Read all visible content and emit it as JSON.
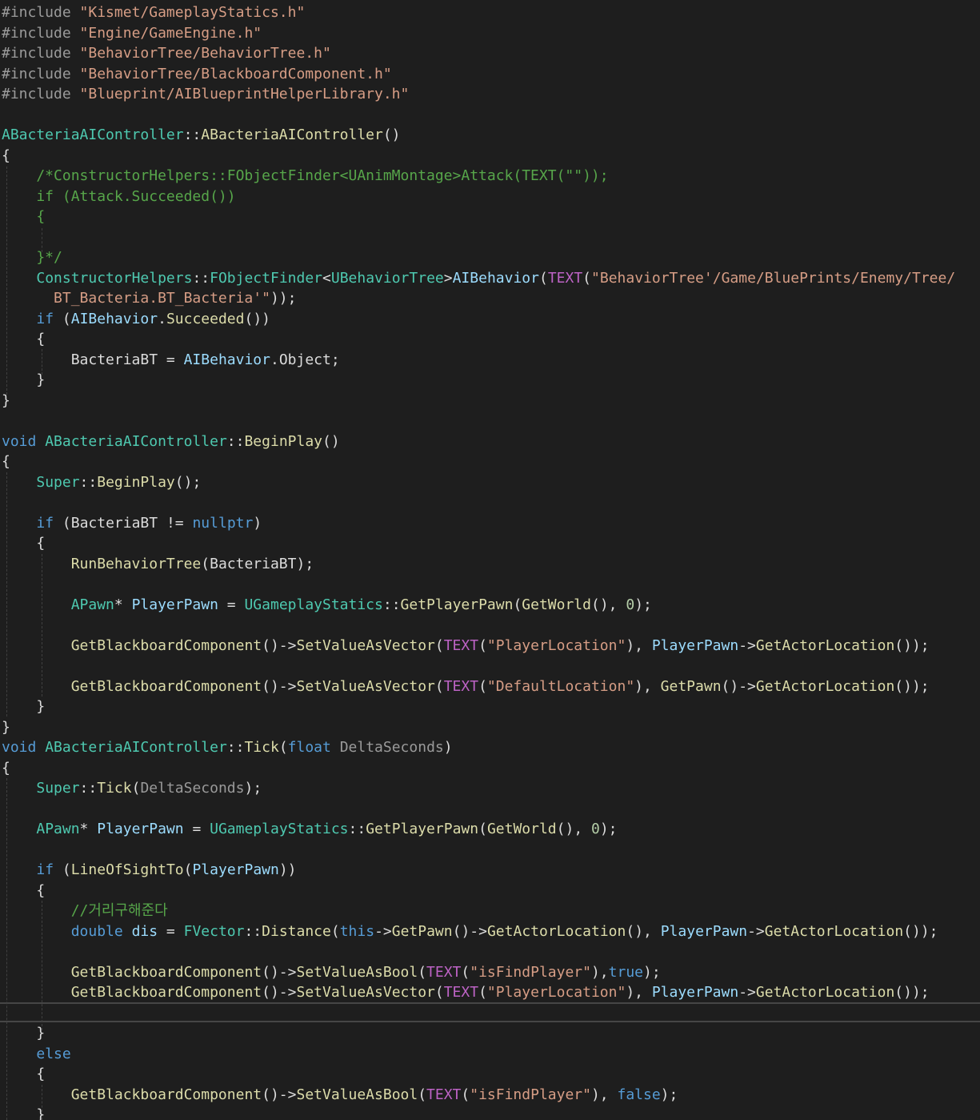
{
  "editor": {
    "colors": {
      "background": "#1e1e1e",
      "plain": "#dcdcdc",
      "keyword": "#569cd6",
      "type": "#4ec9b0",
      "function": "#dcdcaa",
      "string": "#d69d85",
      "comment": "#57a64a",
      "macro": "#bd63c5",
      "parameter": "#9a9a9a",
      "variable": "#9cdcfe",
      "number": "#b5cea8",
      "include": "#9b9b9b"
    },
    "lines": [
      [
        {
          "t": "#include ",
          "c": "include"
        },
        {
          "t": "\"Kismet/GameplayStatics.h\"",
          "c": "string"
        }
      ],
      [
        {
          "t": "#include ",
          "c": "include"
        },
        {
          "t": "\"Engine/GameEngine.h\"",
          "c": "string"
        }
      ],
      [
        {
          "t": "#include ",
          "c": "include"
        },
        {
          "t": "\"BehaviorTree/BehaviorTree.h\"",
          "c": "string"
        }
      ],
      [
        {
          "t": "#include ",
          "c": "include"
        },
        {
          "t": "\"BehaviorTree/BlackboardComponent.h\"",
          "c": "string"
        }
      ],
      [
        {
          "t": "#include ",
          "c": "include"
        },
        {
          "t": "\"Blueprint/AIBlueprintHelperLibrary.h\"",
          "c": "string"
        }
      ],
      [],
      [
        {
          "t": "ABacteriaAIController",
          "c": "type"
        },
        {
          "t": "::",
          "c": "plain"
        },
        {
          "t": "ABacteriaAIController",
          "c": "function"
        },
        {
          "t": "()",
          "c": "plain"
        }
      ],
      [
        {
          "t": "{",
          "c": "plain"
        }
      ],
      [
        {
          "t": "    /*ConstructorHelpers::FObjectFinder<UAnimMontage>Attack(TEXT(\"\"));",
          "c": "comment"
        }
      ],
      [
        {
          "t": "    if (Attack.Succeeded())",
          "c": "comment"
        }
      ],
      [
        {
          "t": "    {",
          "c": "comment"
        }
      ],
      [],
      [
        {
          "t": "    }*/",
          "c": "comment"
        }
      ],
      [
        {
          "t": "    ",
          "c": "plain"
        },
        {
          "t": "ConstructorHelpers",
          "c": "type"
        },
        {
          "t": "::",
          "c": "plain"
        },
        {
          "t": "FObjectFinder",
          "c": "type"
        },
        {
          "t": "<",
          "c": "plain"
        },
        {
          "t": "UBehaviorTree",
          "c": "type"
        },
        {
          "t": ">",
          "c": "plain"
        },
        {
          "t": "AIBehavior",
          "c": "variable"
        },
        {
          "t": "(",
          "c": "plain"
        },
        {
          "t": "TEXT",
          "c": "macro"
        },
        {
          "t": "(",
          "c": "plain"
        },
        {
          "t": "\"BehaviorTree'/Game/BluePrints/Enemy/Tree/",
          "c": "string"
        }
      ],
      [
        {
          "t": "      BT_Bacteria.BT_Bacteria'\"",
          "c": "string"
        },
        {
          "t": "));",
          "c": "plain"
        }
      ],
      [
        {
          "t": "    ",
          "c": "plain"
        },
        {
          "t": "if",
          "c": "keyword"
        },
        {
          "t": " (",
          "c": "plain"
        },
        {
          "t": "AIBehavior",
          "c": "variable"
        },
        {
          "t": ".",
          "c": "plain"
        },
        {
          "t": "Succeeded",
          "c": "function"
        },
        {
          "t": "())",
          "c": "plain"
        }
      ],
      [
        {
          "t": "    {",
          "c": "plain"
        }
      ],
      [
        {
          "t": "        ",
          "c": "plain"
        },
        {
          "t": "BacteriaBT",
          "c": "plain"
        },
        {
          "t": " = ",
          "c": "plain"
        },
        {
          "t": "AIBehavior",
          "c": "variable"
        },
        {
          "t": ".",
          "c": "plain"
        },
        {
          "t": "Object",
          "c": "plain"
        },
        {
          "t": ";",
          "c": "plain"
        }
      ],
      [
        {
          "t": "    }",
          "c": "plain"
        }
      ],
      [
        {
          "t": "}",
          "c": "plain"
        }
      ],
      [],
      [
        {
          "t": "void",
          "c": "keyword"
        },
        {
          "t": " ",
          "c": "plain"
        },
        {
          "t": "ABacteriaAIController",
          "c": "type"
        },
        {
          "t": "::",
          "c": "plain"
        },
        {
          "t": "BeginPlay",
          "c": "function"
        },
        {
          "t": "()",
          "c": "plain"
        }
      ],
      [
        {
          "t": "{",
          "c": "plain"
        }
      ],
      [
        {
          "t": "    ",
          "c": "plain"
        },
        {
          "t": "Super",
          "c": "type"
        },
        {
          "t": "::",
          "c": "plain"
        },
        {
          "t": "BeginPlay",
          "c": "function"
        },
        {
          "t": "();",
          "c": "plain"
        }
      ],
      [],
      [
        {
          "t": "    ",
          "c": "plain"
        },
        {
          "t": "if",
          "c": "keyword"
        },
        {
          "t": " (",
          "c": "plain"
        },
        {
          "t": "BacteriaBT",
          "c": "plain"
        },
        {
          "t": " != ",
          "c": "plain"
        },
        {
          "t": "nullptr",
          "c": "keyword"
        },
        {
          "t": ")",
          "c": "plain"
        }
      ],
      [
        {
          "t": "    {",
          "c": "plain"
        }
      ],
      [
        {
          "t": "        ",
          "c": "plain"
        },
        {
          "t": "RunBehaviorTree",
          "c": "function"
        },
        {
          "t": "(",
          "c": "plain"
        },
        {
          "t": "BacteriaBT",
          "c": "plain"
        },
        {
          "t": ");",
          "c": "plain"
        }
      ],
      [],
      [
        {
          "t": "        ",
          "c": "plain"
        },
        {
          "t": "APawn",
          "c": "type"
        },
        {
          "t": "* ",
          "c": "plain"
        },
        {
          "t": "PlayerPawn",
          "c": "variable"
        },
        {
          "t": " = ",
          "c": "plain"
        },
        {
          "t": "UGameplayStatics",
          "c": "type"
        },
        {
          "t": "::",
          "c": "plain"
        },
        {
          "t": "GetPlayerPawn",
          "c": "function"
        },
        {
          "t": "(",
          "c": "plain"
        },
        {
          "t": "GetWorld",
          "c": "function"
        },
        {
          "t": "(), ",
          "c": "plain"
        },
        {
          "t": "0",
          "c": "number"
        },
        {
          "t": ");",
          "c": "plain"
        }
      ],
      [],
      [
        {
          "t": "        ",
          "c": "plain"
        },
        {
          "t": "GetBlackboardComponent",
          "c": "function"
        },
        {
          "t": "()->",
          "c": "plain"
        },
        {
          "t": "SetValueAsVector",
          "c": "function"
        },
        {
          "t": "(",
          "c": "plain"
        },
        {
          "t": "TEXT",
          "c": "macro"
        },
        {
          "t": "(",
          "c": "plain"
        },
        {
          "t": "\"PlayerLocation\"",
          "c": "string"
        },
        {
          "t": "), ",
          "c": "plain"
        },
        {
          "t": "PlayerPawn",
          "c": "variable"
        },
        {
          "t": "->",
          "c": "plain"
        },
        {
          "t": "GetActorLocation",
          "c": "function"
        },
        {
          "t": "());",
          "c": "plain"
        }
      ],
      [],
      [
        {
          "t": "        ",
          "c": "plain"
        },
        {
          "t": "GetBlackboardComponent",
          "c": "function"
        },
        {
          "t": "()->",
          "c": "plain"
        },
        {
          "t": "SetValueAsVector",
          "c": "function"
        },
        {
          "t": "(",
          "c": "plain"
        },
        {
          "t": "TEXT",
          "c": "macro"
        },
        {
          "t": "(",
          "c": "plain"
        },
        {
          "t": "\"DefaultLocation\"",
          "c": "string"
        },
        {
          "t": "), ",
          "c": "plain"
        },
        {
          "t": "GetPawn",
          "c": "function"
        },
        {
          "t": "()->",
          "c": "plain"
        },
        {
          "t": "GetActorLocation",
          "c": "function"
        },
        {
          "t": "());",
          "c": "plain"
        }
      ],
      [
        {
          "t": "    }",
          "c": "plain"
        }
      ],
      [
        {
          "t": "}",
          "c": "plain"
        }
      ],
      [
        {
          "t": "void",
          "c": "keyword"
        },
        {
          "t": " ",
          "c": "plain"
        },
        {
          "t": "ABacteriaAIController",
          "c": "type"
        },
        {
          "t": "::",
          "c": "plain"
        },
        {
          "t": "Tick",
          "c": "function"
        },
        {
          "t": "(",
          "c": "plain"
        },
        {
          "t": "float",
          "c": "keyword"
        },
        {
          "t": " ",
          "c": "plain"
        },
        {
          "t": "DeltaSeconds",
          "c": "parameter"
        },
        {
          "t": ")",
          "c": "plain"
        }
      ],
      [
        {
          "t": "{",
          "c": "plain"
        }
      ],
      [
        {
          "t": "    ",
          "c": "plain"
        },
        {
          "t": "Super",
          "c": "type"
        },
        {
          "t": "::",
          "c": "plain"
        },
        {
          "t": "Tick",
          "c": "function"
        },
        {
          "t": "(",
          "c": "plain"
        },
        {
          "t": "DeltaSeconds",
          "c": "parameter"
        },
        {
          "t": ");",
          "c": "plain"
        }
      ],
      [],
      [
        {
          "t": "    ",
          "c": "plain"
        },
        {
          "t": "APawn",
          "c": "type"
        },
        {
          "t": "* ",
          "c": "plain"
        },
        {
          "t": "PlayerPawn",
          "c": "variable"
        },
        {
          "t": " = ",
          "c": "plain"
        },
        {
          "t": "UGameplayStatics",
          "c": "type"
        },
        {
          "t": "::",
          "c": "plain"
        },
        {
          "t": "GetPlayerPawn",
          "c": "function"
        },
        {
          "t": "(",
          "c": "plain"
        },
        {
          "t": "GetWorld",
          "c": "function"
        },
        {
          "t": "(), ",
          "c": "plain"
        },
        {
          "t": "0",
          "c": "number"
        },
        {
          "t": ");",
          "c": "plain"
        }
      ],
      [],
      [
        {
          "t": "    ",
          "c": "plain"
        },
        {
          "t": "if",
          "c": "keyword"
        },
        {
          "t": " (",
          "c": "plain"
        },
        {
          "t": "LineOfSightTo",
          "c": "function"
        },
        {
          "t": "(",
          "c": "plain"
        },
        {
          "t": "PlayerPawn",
          "c": "variable"
        },
        {
          "t": "))",
          "c": "plain"
        }
      ],
      [
        {
          "t": "    {",
          "c": "plain"
        }
      ],
      [
        {
          "t": "        //거리구해준다",
          "c": "comment"
        }
      ],
      [
        {
          "t": "        ",
          "c": "plain"
        },
        {
          "t": "double",
          "c": "keyword"
        },
        {
          "t": " ",
          "c": "plain"
        },
        {
          "t": "dis",
          "c": "variable"
        },
        {
          "t": " = ",
          "c": "plain"
        },
        {
          "t": "FVector",
          "c": "type"
        },
        {
          "t": "::",
          "c": "plain"
        },
        {
          "t": "Distance",
          "c": "function"
        },
        {
          "t": "(",
          "c": "plain"
        },
        {
          "t": "this",
          "c": "keyword"
        },
        {
          "t": "->",
          "c": "plain"
        },
        {
          "t": "GetPawn",
          "c": "function"
        },
        {
          "t": "()->",
          "c": "plain"
        },
        {
          "t": "GetActorLocation",
          "c": "function"
        },
        {
          "t": "(), ",
          "c": "plain"
        },
        {
          "t": "PlayerPawn",
          "c": "variable"
        },
        {
          "t": "->",
          "c": "plain"
        },
        {
          "t": "GetActorLocation",
          "c": "function"
        },
        {
          "t": "());",
          "c": "plain"
        }
      ],
      [],
      [
        {
          "t": "        ",
          "c": "plain"
        },
        {
          "t": "GetBlackboardComponent",
          "c": "function"
        },
        {
          "t": "()->",
          "c": "plain"
        },
        {
          "t": "SetValueAsBool",
          "c": "function"
        },
        {
          "t": "(",
          "c": "plain"
        },
        {
          "t": "TEXT",
          "c": "macro"
        },
        {
          "t": "(",
          "c": "plain"
        },
        {
          "t": "\"isFindPlayer\"",
          "c": "string"
        },
        {
          "t": "),",
          "c": "plain"
        },
        {
          "t": "true",
          "c": "keyword"
        },
        {
          "t": ");",
          "c": "plain"
        }
      ],
      [
        {
          "t": "        ",
          "c": "plain"
        },
        {
          "t": "GetBlackboardComponent",
          "c": "function"
        },
        {
          "t": "()->",
          "c": "plain"
        },
        {
          "t": "SetValueAsVector",
          "c": "function"
        },
        {
          "t": "(",
          "c": "plain"
        },
        {
          "t": "TEXT",
          "c": "macro"
        },
        {
          "t": "(",
          "c": "plain"
        },
        {
          "t": "\"PlayerLocation\"",
          "c": "string"
        },
        {
          "t": "), ",
          "c": "plain"
        },
        {
          "t": "PlayerPawn",
          "c": "variable"
        },
        {
          "t": "->",
          "c": "plain"
        },
        {
          "t": "GetActorLocation",
          "c": "function"
        },
        {
          "t": "());",
          "c": "plain"
        }
      ],
      [],
      [
        {
          "t": "    }",
          "c": "plain"
        }
      ],
      [
        {
          "t": "    ",
          "c": "plain"
        },
        {
          "t": "else",
          "c": "keyword"
        }
      ],
      [
        {
          "t": "    {",
          "c": "plain"
        }
      ],
      [
        {
          "t": "        ",
          "c": "plain"
        },
        {
          "t": "GetBlackboardComponent",
          "c": "function"
        },
        {
          "t": "()->",
          "c": "plain"
        },
        {
          "t": "SetValueAsBool",
          "c": "function"
        },
        {
          "t": "(",
          "c": "plain"
        },
        {
          "t": "TEXT",
          "c": "macro"
        },
        {
          "t": "(",
          "c": "plain"
        },
        {
          "t": "\"isFindPlayer\"",
          "c": "string"
        },
        {
          "t": "), ",
          "c": "plain"
        },
        {
          "t": "false",
          "c": "keyword"
        },
        {
          "t": ");",
          "c": "plain"
        }
      ],
      [
        {
          "t": "    }",
          "c": "plain"
        }
      ]
    ]
  }
}
